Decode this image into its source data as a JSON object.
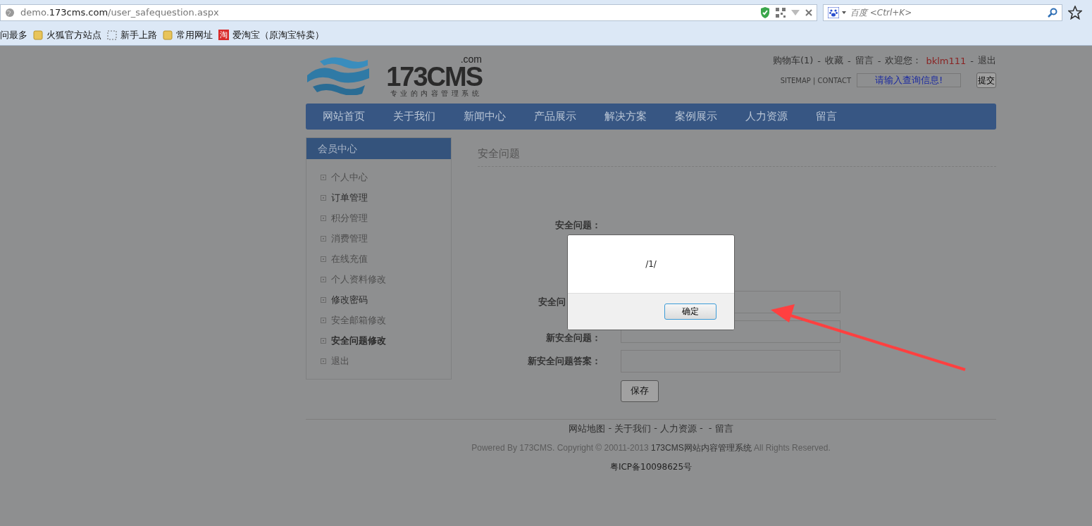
{
  "browser": {
    "url": "demo.**173cms.com**/user_safequestion.aspx",
    "search_placeholder": "百度 <Ctrl+K>",
    "bookmarks": [
      {
        "label": "问最多",
        "kind": "none"
      },
      {
        "label": "火狐官方站点",
        "kind": "folder"
      },
      {
        "label": "新手上路",
        "kind": "blank"
      },
      {
        "label": "常用网址",
        "kind": "folder"
      },
      {
        "label": "爱淘宝（原淘宝特卖）",
        "kind": "badge",
        "badge": "淘"
      }
    ]
  },
  "header": {
    "logo": {
      "name": "173CMS",
      "suffix": ".com",
      "tagline": "专业的内容管理系统"
    },
    "links": [
      {
        "text": "购物车(1)",
        "after": "-"
      },
      {
        "text": "收藏",
        "after": "-"
      },
      {
        "text": "留言",
        "after": "-"
      }
    ],
    "welcome": "欢迎您：",
    "user": "bklm111",
    "logout_separator": "-",
    "logout": "退出",
    "sitemap": "SITEMAP | CONTACT",
    "search_value": "请输入查询信息!",
    "submit": "提交"
  },
  "nav": [
    "网站首页",
    "关于我们",
    "新闻中心",
    "产品展示",
    "解决方案",
    "案例展示",
    "人力资源",
    "留言"
  ],
  "sidebar": {
    "title": "会员中心",
    "items": [
      {
        "label": "个人中心",
        "selected": false,
        "visited": false
      },
      {
        "label": "订单管理",
        "selected": false,
        "visited": true
      },
      {
        "label": "积分管理",
        "selected": false,
        "visited": false
      },
      {
        "label": "消费管理",
        "selected": false,
        "visited": false
      },
      {
        "label": "在线充值",
        "selected": false,
        "visited": false
      },
      {
        "label": "个人资料修改",
        "selected": false,
        "visited": false
      },
      {
        "label": "修改密码",
        "selected": false,
        "visited": true
      },
      {
        "label": "安全邮箱修改",
        "selected": false,
        "visited": false
      },
      {
        "label": "安全问题修改",
        "selected": true,
        "visited": false
      },
      {
        "label": "退出",
        "selected": false,
        "visited": false
      }
    ]
  },
  "main": {
    "title": "安全问题",
    "form": [
      {
        "label": "安全问题：",
        "kind": "text"
      },
      {
        "label": "安全问",
        "kind": "input"
      },
      {
        "label": "新安全问题：",
        "kind": "input"
      },
      {
        "label": "新安全问题答案：",
        "kind": "input"
      }
    ],
    "save": "保存"
  },
  "dialog": {
    "message": "/1/",
    "ok": "确定"
  },
  "footer": {
    "links": [
      {
        "text": "网站地图",
        "after": "-"
      },
      {
        "text": "关于我们",
        "after": "-"
      },
      {
        "text": "人力资源",
        "after": "-  -"
      },
      {
        "text": "留言"
      }
    ],
    "copyright": "Powered By 173CMS. Copyright © 20011-2013 **173CMS网站内容管理系统** All Rights Reserved.",
    "icp": "粤ICP备10098625号"
  }
}
